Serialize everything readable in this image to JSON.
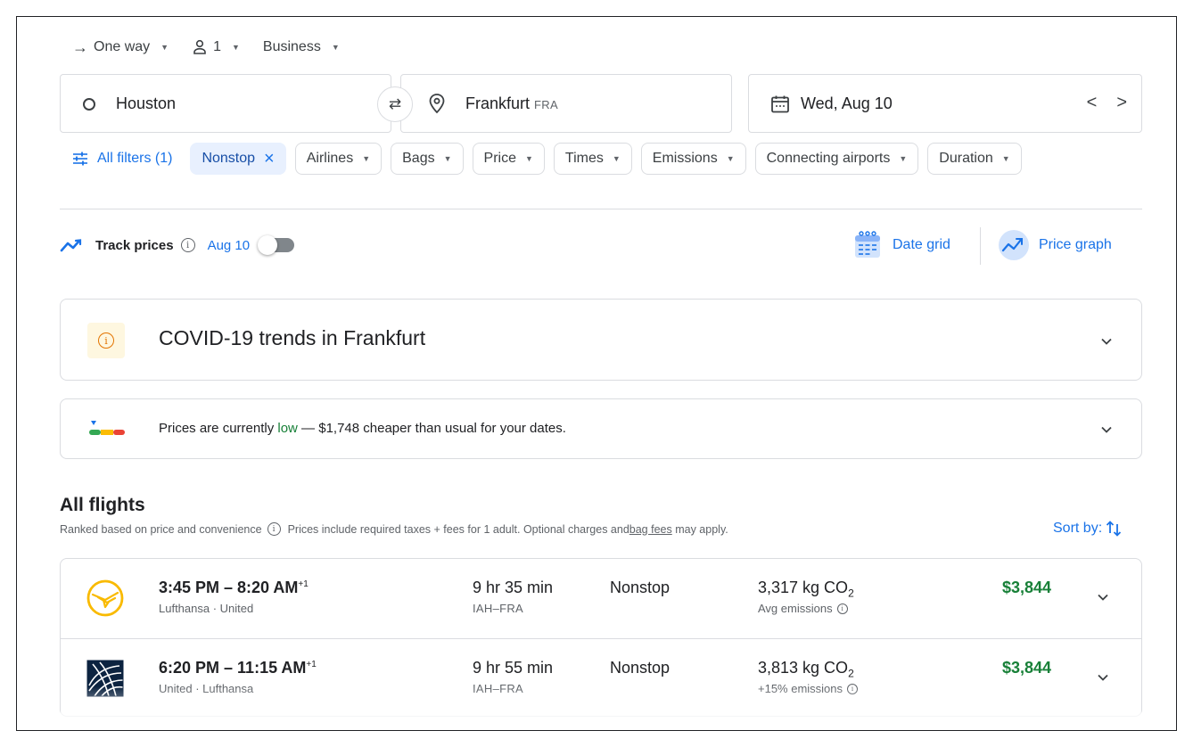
{
  "trip_options": {
    "trip_type": "One way",
    "passengers": "1",
    "cabin_class": "Business"
  },
  "search": {
    "origin": "Houston",
    "destination": "Frankfurt",
    "destination_code": "FRA",
    "date": "Wed, Aug 10",
    "prev_date_glyph": "<",
    "next_date_glyph": ">"
  },
  "filters": {
    "all_filters": "All filters (1)",
    "chips": [
      "Nonstop",
      "Airlines",
      "Bags",
      "Price",
      "Times",
      "Emissions",
      "Connecting airports",
      "Duration"
    ]
  },
  "track": {
    "label": "Track prices",
    "date": "Aug 10",
    "enabled": false,
    "date_grid": "Date grid",
    "price_graph": "Price graph"
  },
  "covid": {
    "title": "COVID-19 trends in Frankfurt"
  },
  "price_insight": {
    "prefix": "Prices are currently ",
    "level": "low",
    "suffix": " — $1,748 cheaper than usual for your dates.",
    "level_color": "#188038"
  },
  "results": {
    "title": "All flights",
    "ranking_note": "Ranked based on price and convenience",
    "taxes_note": "Prices include required taxes + fees for 1 adult. Optional charges and ",
    "bag_fees_link": "bag fees",
    "taxes_tail": " may apply.",
    "sort_label": "Sort by:"
  },
  "flights": [
    {
      "times": "3:45 PM – 8:20 AM",
      "day_offset": "+1",
      "airlines": "Lufthansa · United",
      "duration": "9 hr 35 min",
      "route": "IAH–FRA",
      "stops": "Nonstop",
      "emissions": "3,317 kg CO",
      "emissions_sub": "2",
      "emissions_note": "Avg emissions",
      "price": "$3,844",
      "logo": "lufthansa-logo"
    },
    {
      "times": "6:20 PM – 11:15 AM",
      "day_offset": "+1",
      "airlines": "United · Lufthansa",
      "duration": "9 hr 55 min",
      "route": "IAH–FRA",
      "stops": "Nonstop",
      "emissions": "3,813 kg CO",
      "emissions_sub": "2",
      "emissions_note": "+15% emissions",
      "price": "$3,844",
      "logo": "united-logo"
    }
  ],
  "colors": {
    "accent": "#1a73e8",
    "price_green": "#188038",
    "border": "#dadce0"
  }
}
